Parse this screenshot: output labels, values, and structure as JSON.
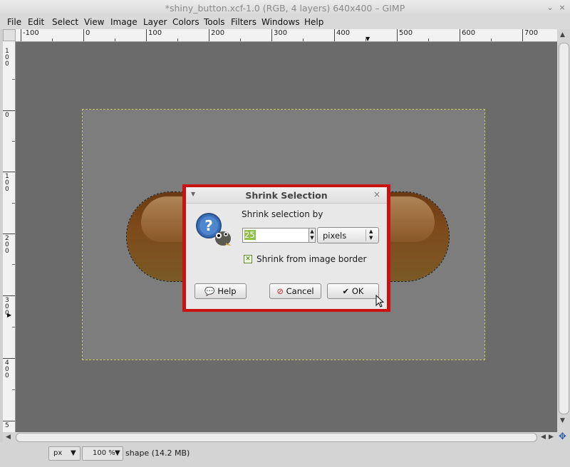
{
  "window": {
    "title": "*shiny_button.xcf-1.0 (RGB, 4 layers) 640x400 – GIMP",
    "minimize": "⌄",
    "close": "×"
  },
  "menu": [
    "File",
    "Edit",
    "Select",
    "View",
    "Image",
    "Layer",
    "Colors",
    "Tools",
    "Filters",
    "Windows",
    "Help"
  ],
  "ruler": {
    "h_labels": [
      "-100",
      "0",
      "100",
      "200",
      "300",
      "400",
      "500",
      "600",
      "700"
    ],
    "v_labels": [
      "100",
      "0",
      "100",
      "200",
      "300",
      "400",
      "5"
    ]
  },
  "statusbar": {
    "unit": "px",
    "zoom": "100 %",
    "status": "shape (14.2 MB)"
  },
  "dialog": {
    "title": "Shrink Selection",
    "prompt": "Shrink selection by",
    "value": "25",
    "unit": "pixels",
    "checkbox_label": "Shrink from image border",
    "checkbox_checked": true,
    "help": "Help",
    "cancel": "Cancel",
    "ok": "OK"
  },
  "colors": {
    "highlight_border": "#cc1111",
    "canvas_bg": "#6b6b6b",
    "button_shape": "#7a4a1a"
  }
}
